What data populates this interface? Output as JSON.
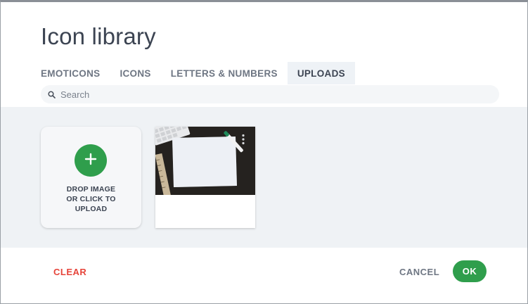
{
  "dialog": {
    "title": "Icon library"
  },
  "tabs": [
    {
      "label": "EMOTICONS",
      "active": false
    },
    {
      "label": "ICONS",
      "active": false
    },
    {
      "label": "LETTERS & NUMBERS",
      "active": false
    },
    {
      "label": "UPLOADS",
      "active": true
    }
  ],
  "search": {
    "placeholder": "Search",
    "value": "",
    "icon": "search-icon"
  },
  "uploads": {
    "dropzone_label": "DROP IMAGE OR CLICK TO UPLOAD",
    "dropzone_icon": "plus-icon",
    "items": [
      {
        "description": "uploaded image thumbnail",
        "menu_icon": "kebab-menu-icon"
      }
    ]
  },
  "footer": {
    "clear_label": "CLEAR",
    "cancel_label": "CANCEL",
    "ok_label": "OK"
  },
  "colors": {
    "accent_green": "#2f9e4c",
    "danger_red": "#e6443a",
    "panel_bg": "#eff2f5",
    "active_tab_bg": "#eef2f6"
  }
}
